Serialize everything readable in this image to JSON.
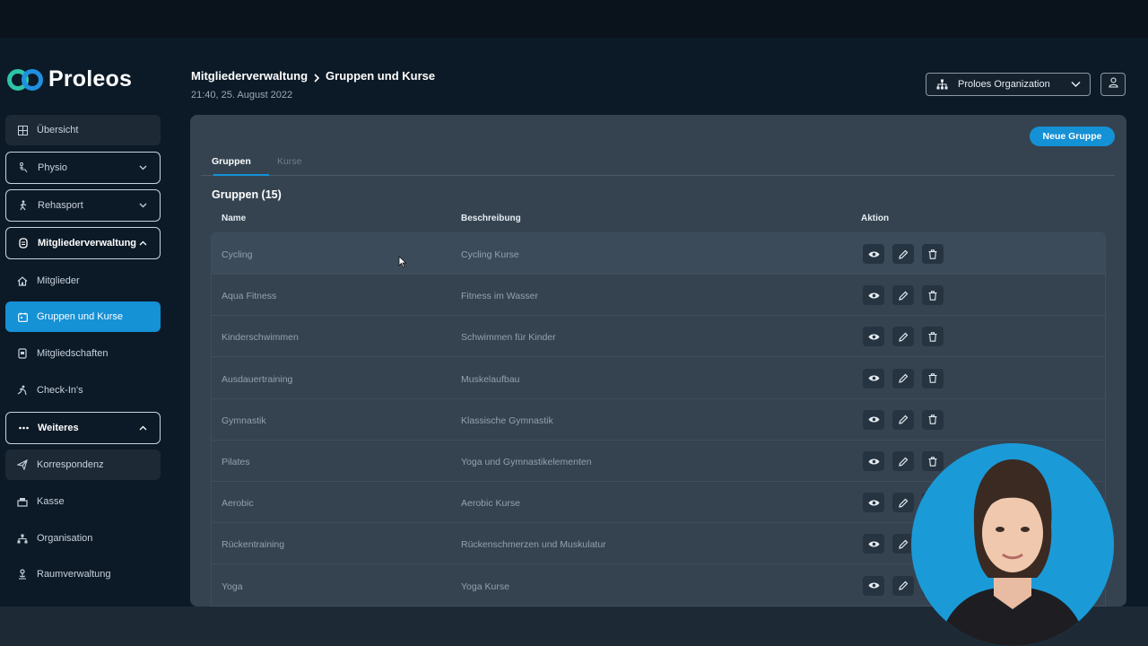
{
  "app": {
    "name": "Proleos"
  },
  "sidebar": {
    "items": [
      {
        "label": "Übersicht",
        "icon": "grid-icon"
      },
      {
        "label": "Physio",
        "icon": "physio-icon"
      },
      {
        "label": "Rehasport",
        "icon": "walking-icon"
      },
      {
        "label": "Mitgliederverwaltung",
        "icon": "badge-icon"
      },
      {
        "label": "Mitglieder",
        "icon": "home-icon"
      },
      {
        "label": "Gruppen und Kurse",
        "icon": "calendar-icon"
      },
      {
        "label": "Mitgliedschaften",
        "icon": "card-icon"
      },
      {
        "label": "Check-In's",
        "icon": "checkin-icon"
      },
      {
        "label": "Weiteres",
        "icon": "dots-icon"
      },
      {
        "label": "Korrespondenz",
        "icon": "send-icon"
      },
      {
        "label": "Kasse",
        "icon": "register-icon"
      },
      {
        "label": "Organisation",
        "icon": "org-icon"
      },
      {
        "label": "Raumverwaltung",
        "icon": "room-icon"
      }
    ]
  },
  "header": {
    "breadcrumb": [
      "Mitgliederverwaltung",
      "Gruppen und Kurse"
    ],
    "datetime": "21:40, 25. August 2022",
    "org_select": "Proloes Organization"
  },
  "main": {
    "new_button": "Neue Gruppe",
    "tabs": [
      {
        "label": "Gruppen"
      },
      {
        "label": "Kurse"
      }
    ],
    "section_title": "Gruppen (15)",
    "columns": [
      "Name",
      "Beschreibung",
      "Aktion"
    ],
    "rows": [
      {
        "name": "Cycling",
        "description": "Cycling Kurse"
      },
      {
        "name": "Aqua Fitness",
        "description": "Fitness im Wasser"
      },
      {
        "name": "Kinderschwimmen",
        "description": "Schwimmen für Kinder"
      },
      {
        "name": "Ausdauertraining",
        "description": "Muskelaufbau"
      },
      {
        "name": "Gymnastik",
        "description": "Klassische Gymnastik"
      },
      {
        "name": "Pilates",
        "description": "Yoga und Gymnastikelementen"
      },
      {
        "name": "Aerobic",
        "description": "Aerobic Kurse"
      },
      {
        "name": "Rückentraining",
        "description": "Rückenschmerzen und Muskulatur"
      },
      {
        "name": "Yoga",
        "description": "Yoga Kurse"
      }
    ]
  },
  "colors": {
    "accent": "#1591d6",
    "logo_green": "#2ec4a8",
    "panel": "#354350",
    "background": "#0c1a27"
  }
}
